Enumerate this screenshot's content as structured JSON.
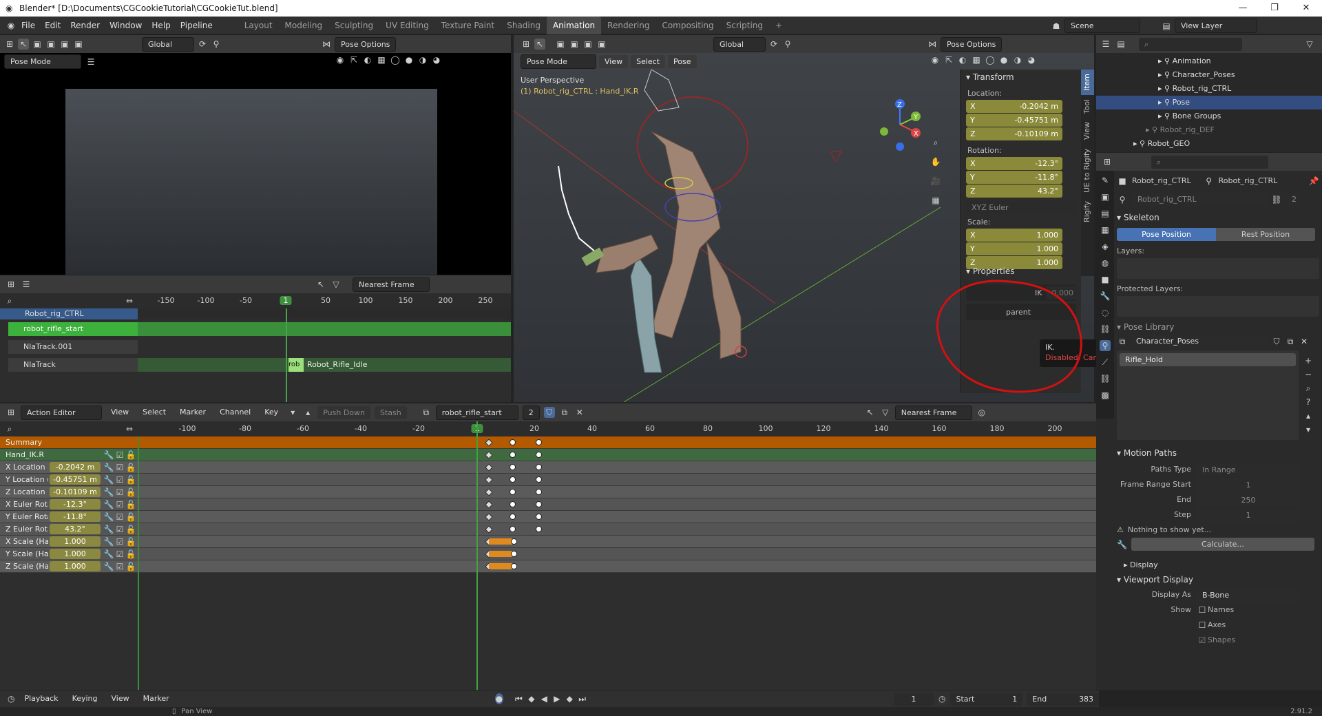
{
  "window": {
    "title": "Blender* [D:\\Documents\\CGCookieTutorial\\CGCookieTut.blend]"
  },
  "menu": {
    "items": [
      "File",
      "Edit",
      "Render",
      "Window",
      "Help",
      "Pipeline"
    ]
  },
  "workspaces": [
    "Layout",
    "Modeling",
    "Sculpting",
    "UV Editing",
    "Texture Paint",
    "Shading",
    "Animation",
    "Rendering",
    "Compositing",
    "Scripting"
  ],
  "active_workspace": "Animation",
  "scene": {
    "label": "Scene",
    "view_layer": "View Layer"
  },
  "left_viewport": {
    "mode": "Pose Mode",
    "orientation": "Global",
    "pose_options": "Pose Options"
  },
  "viewport": {
    "mode": "Pose Mode",
    "menus": [
      "View",
      "Select",
      "Pose"
    ],
    "orientation": "Global",
    "pose_options": "Pose Options",
    "perspective": "User Perspective",
    "object_info": "(1) Robot_rig_CTRL : Hand_IK.R"
  },
  "transform_panel": {
    "title": "Transform",
    "location_label": "Location:",
    "location": [
      {
        "axis": "X",
        "value": "-0.2042 m"
      },
      {
        "axis": "Y",
        "value": "-0.45751 m"
      },
      {
        "axis": "Z",
        "value": "-0.10109 m"
      }
    ],
    "rotation_label": "Rotation:",
    "rotation": [
      {
        "axis": "X",
        "value": "-12.3°"
      },
      {
        "axis": "Y",
        "value": "-11.8°"
      },
      {
        "axis": "Z",
        "value": "43.2°"
      }
    ],
    "rotation_mode": "XYZ Euler",
    "scale_label": "Scale:",
    "scale": [
      {
        "axis": "X",
        "value": "1.000"
      },
      {
        "axis": "Y",
        "value": "1.000"
      },
      {
        "axis": "Z",
        "value": "1.000"
      }
    ],
    "properties_title": "Properties",
    "ik_label": "IK",
    "ik_value": "0.000",
    "parent_label": "parent",
    "tooltip_title": "IK.",
    "tooltip_msg": "Disabled: Can't edit this property from an override data-block"
  },
  "side_tabs": [
    "Item",
    "Tool",
    "View",
    "UE to Rigify",
    "Rigify"
  ],
  "nla": {
    "snap": "Nearest Frame",
    "ruler": [
      "-150",
      "-100",
      "-50",
      "1",
      "50",
      "100",
      "150",
      "200",
      "250"
    ],
    "tracks": [
      {
        "name": "Robot_rig_CTRL"
      },
      {
        "name": "robot_rifle_start"
      },
      {
        "name": "NlaTrack.001"
      },
      {
        "name": "NlaTrack"
      }
    ],
    "strip_short": "rob",
    "strip": "Robot_Rifle_Idle"
  },
  "action_editor": {
    "mode": "Action Editor",
    "menus": [
      "View",
      "Select",
      "Marker",
      "Channel",
      "Key"
    ],
    "push_down": "Push Down",
    "stash": "Stash",
    "action": "robot_rifle_start",
    "users": "2",
    "snap": "Nearest Frame",
    "ruler": [
      "-100",
      "-80",
      "-60",
      "-40",
      "-20",
      "1",
      "20",
      "40",
      "60",
      "80",
      "100",
      "120",
      "140",
      "160",
      "180",
      "200"
    ],
    "summary": "Summary",
    "group": "Hand_IK.R",
    "channels": [
      {
        "name": "X Location (",
        "value": "-0.2042 m"
      },
      {
        "name": "Y Location (",
        "value": "-0.45751 m"
      },
      {
        "name": "Z Location (",
        "value": "-0.10109 m"
      },
      {
        "name": "X Euler Rota",
        "value": "-12.3°"
      },
      {
        "name": "Y Euler Rota",
        "value": "-11.8°"
      },
      {
        "name": "Z Euler Rota",
        "value": "43.2°"
      },
      {
        "name": "X Scale (Ha",
        "value": "1.000"
      },
      {
        "name": "Y Scale (Ha",
        "value": "1.000"
      },
      {
        "name": "Z Scale (Ha",
        "value": "1.000"
      }
    ]
  },
  "playback": {
    "menus": [
      "Playback",
      "Keying",
      "View",
      "Marker"
    ],
    "current_frame": "1",
    "start_label": "Start",
    "start": "1",
    "end_label": "End",
    "end": "383"
  },
  "status": {
    "pan": "Pan View",
    "version": "2.91.2"
  },
  "outliner": {
    "rows": [
      {
        "name": "Animation",
        "indent": 5
      },
      {
        "name": "Character_Poses",
        "indent": 5
      },
      {
        "name": "Robot_rig_CTRL",
        "indent": 5
      },
      {
        "name": "Pose",
        "indent": 5,
        "selected": true
      },
      {
        "name": "Bone Groups",
        "indent": 5
      },
      {
        "name": "Robot_rig_DEF",
        "indent": 4,
        "dim": true
      },
      {
        "name": "Robot_GEO",
        "indent": 3
      }
    ]
  },
  "properties": {
    "object": "Robot_rig_CTRL",
    "data": "Robot_rig_CTRL",
    "armature": "Robot_rig_CTRL",
    "users": "2",
    "skeleton": "Skeleton",
    "pose_position": "Pose Position",
    "rest_position": "Rest Position",
    "layers": "Layers:",
    "protected_layers": "Protected Layers:",
    "pose_library": "Pose Library",
    "pose_library_name": "Character_Poses",
    "pose_item": "Rifle_Hold",
    "motion_paths": "Motion Paths",
    "paths_type_label": "Paths Type",
    "paths_type": "In Range",
    "frame_range_start_label": "Frame Range Start",
    "frame_range_start": "1",
    "end_label": "End",
    "end": "250",
    "step_label": "Step",
    "step": "1",
    "nothing": "Nothing to show yet...",
    "calculate": "Calculate...",
    "display": "Display",
    "viewport_display": "Viewport Display",
    "display_as_label": "Display As",
    "display_as": "B-Bone",
    "show_label": "Show",
    "show_names": "Names",
    "show_axes": "Axes",
    "show_shapes": "Shapes"
  }
}
